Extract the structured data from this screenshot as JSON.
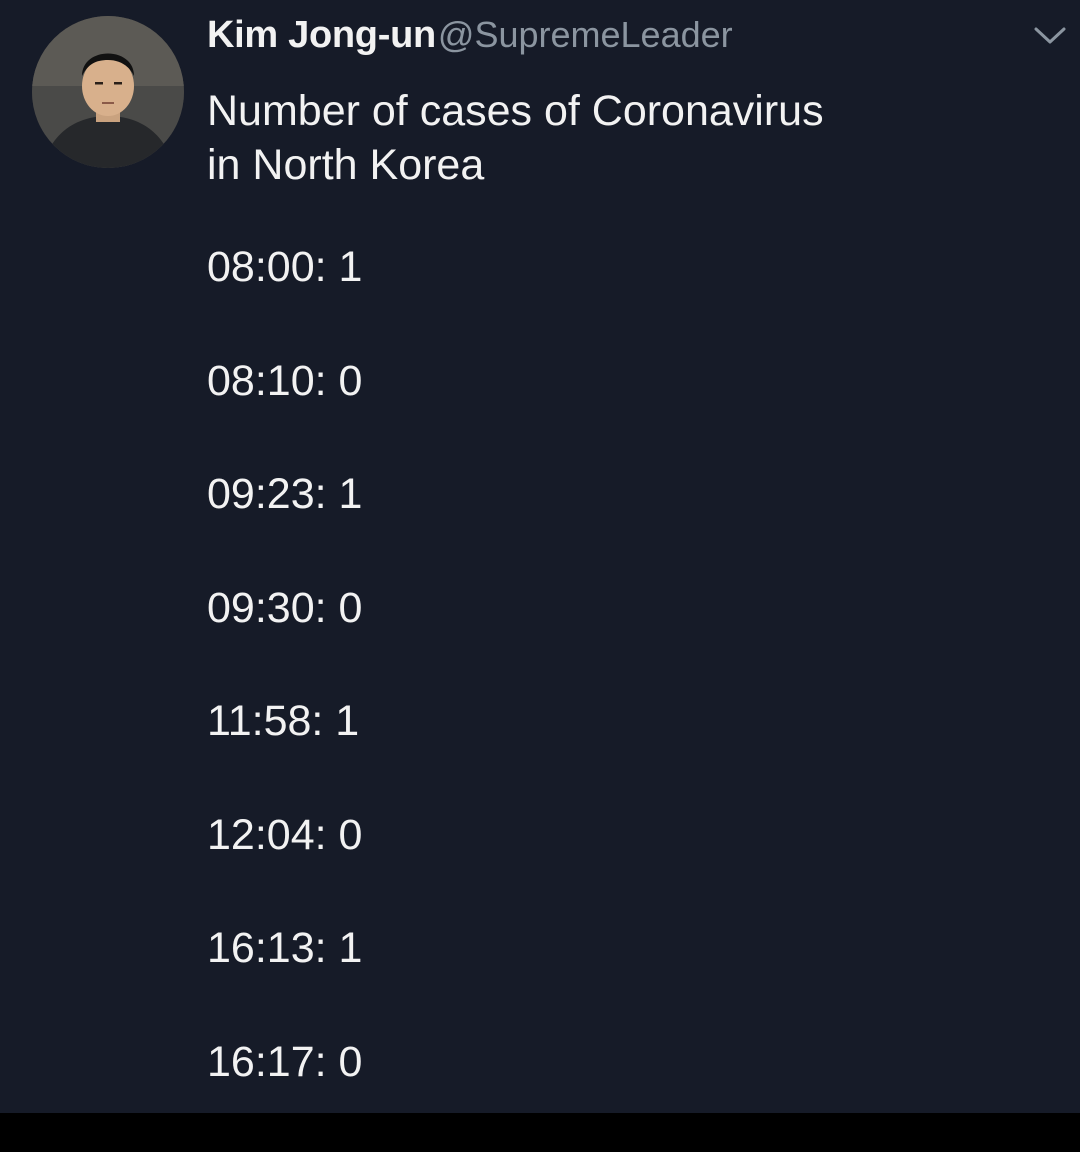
{
  "tweet": {
    "author": {
      "display_name": "Kim Jong-un",
      "handle": "@SupremeLeader",
      "avatar_icon": "profile-photo"
    },
    "menu_icon": "chevron-down-icon",
    "text_lines": [
      "Number of cases of Coronavirus",
      "in North Korea"
    ],
    "entries": [
      "08:00: 1",
      "08:10: 0",
      "09:23: 1",
      "09:30: 0",
      "11:58: 1",
      "12:04: 0",
      "16:13: 1",
      "16:17: 0"
    ]
  },
  "colors": {
    "background": "#161b28",
    "text": "#f2f2f2",
    "handle": "#8b95a0",
    "bottom_bar": "#000000"
  }
}
